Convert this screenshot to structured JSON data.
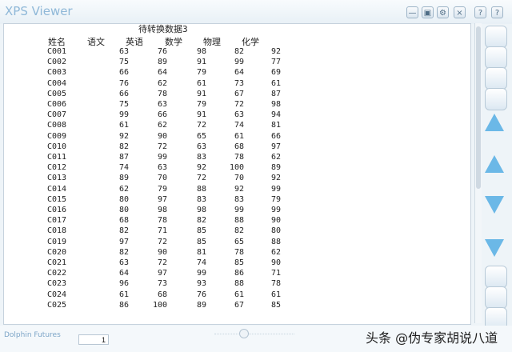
{
  "app": {
    "title": "XPS Viewer"
  },
  "window_controls": {
    "min": "—",
    "restore": "▣",
    "settings": "⚙",
    "close": "×",
    "help1": "?",
    "help2": "?"
  },
  "document": {
    "title": "待转换数据3",
    "headers": [
      "姓名",
      "语文",
      "英语",
      "数学",
      "物理",
      "化学"
    ],
    "rows": [
      [
        "C001",
        "63",
        "76",
        "98",
        "82",
        "92"
      ],
      [
        "C002",
        "75",
        "89",
        "91",
        "99",
        "77"
      ],
      [
        "C003",
        "66",
        "64",
        "79",
        "64",
        "69"
      ],
      [
        "C004",
        "76",
        "62",
        "61",
        "73",
        "61"
      ],
      [
        "C005",
        "66",
        "78",
        "91",
        "67",
        "87"
      ],
      [
        "C006",
        "75",
        "63",
        "79",
        "72",
        "98"
      ],
      [
        "C007",
        "99",
        "66",
        "91",
        "63",
        "94"
      ],
      [
        "C008",
        "61",
        "62",
        "72",
        "74",
        "81"
      ],
      [
        "C009",
        "92",
        "90",
        "65",
        "61",
        "66"
      ],
      [
        "C010",
        "82",
        "72",
        "63",
        "68",
        "97"
      ],
      [
        "C011",
        "87",
        "99",
        "83",
        "78",
        "62"
      ],
      [
        "C012",
        "74",
        "63",
        "92",
        "100",
        "89"
      ],
      [
        "C013",
        "89",
        "70",
        "72",
        "70",
        "92"
      ],
      [
        "C014",
        "62",
        "79",
        "88",
        "92",
        "99"
      ],
      [
        "C015",
        "80",
        "97",
        "83",
        "83",
        "79"
      ],
      [
        "C016",
        "80",
        "98",
        "98",
        "99",
        "99"
      ],
      [
        "C017",
        "68",
        "78",
        "82",
        "88",
        "90"
      ],
      [
        "C018",
        "82",
        "71",
        "85",
        "82",
        "80"
      ],
      [
        "C019",
        "97",
        "72",
        "85",
        "65",
        "88"
      ],
      [
        "C020",
        "82",
        "90",
        "81",
        "78",
        "62"
      ],
      [
        "C021",
        "63",
        "72",
        "74",
        "85",
        "90"
      ],
      [
        "C022",
        "64",
        "97",
        "99",
        "86",
        "71"
      ],
      [
        "C023",
        "96",
        "73",
        "93",
        "88",
        "78"
      ],
      [
        "C024",
        "61",
        "68",
        "76",
        "61",
        "61"
      ],
      [
        "C025",
        "86",
        "100",
        "89",
        "67",
        "85"
      ]
    ]
  },
  "footer": {
    "brand": "Dolphin Futures",
    "page_number": "1",
    "watermark": "头条 @伪专家胡说八道"
  }
}
